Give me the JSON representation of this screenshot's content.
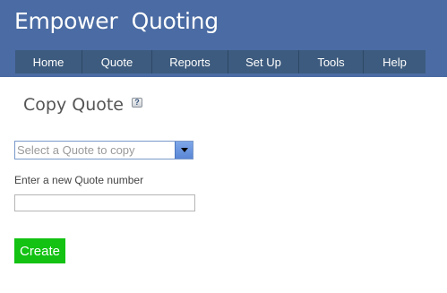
{
  "app": {
    "title": "Empower  Quoting"
  },
  "nav": {
    "items": [
      {
        "label": "Home"
      },
      {
        "label": "Quote"
      },
      {
        "label": "Reports"
      },
      {
        "label": "Set Up"
      },
      {
        "label": "Tools"
      },
      {
        "label": "Help"
      }
    ]
  },
  "page": {
    "title": "Copy Quote",
    "help_icon": "?"
  },
  "form": {
    "quote_select": {
      "selected": "Select a Quote to copy"
    },
    "new_number_label": "Enter a new Quote number",
    "new_number_value": "",
    "create_label": "Create"
  },
  "colors": {
    "header_bg": "#4a6ba3",
    "nav_bg": "#3d5b7e",
    "create_button": "#13c213",
    "select_arrow": "#5a86d6"
  }
}
